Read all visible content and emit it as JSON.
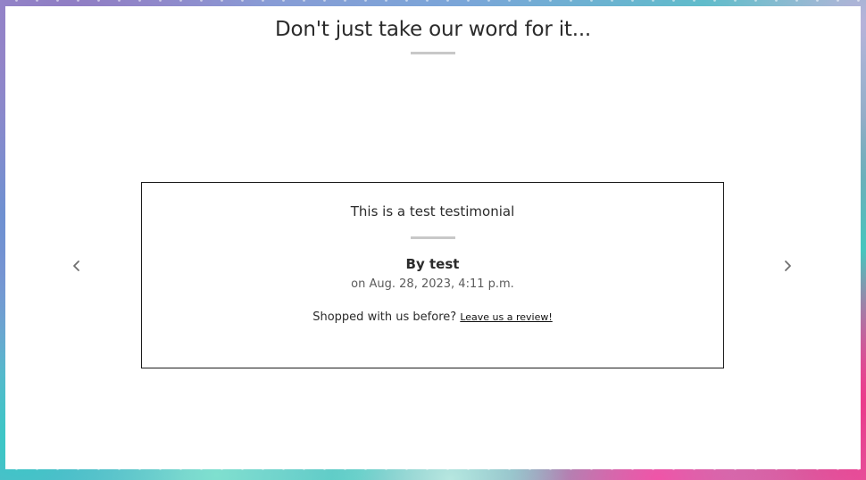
{
  "section": {
    "heading": "Don't just take our word for it..."
  },
  "testimonial": {
    "quote": "This is a test testimonial",
    "author": "By test",
    "date": "on Aug. 28, 2023, 4:11 p.m.",
    "cta_text": "Shopped with us before?",
    "cta_link": "Leave us a review!"
  },
  "carousel": {
    "prev_icon": "chevron-left-icon",
    "next_icon": "chevron-right-icon"
  },
  "colors": {
    "text": "#2b2b2b",
    "muted": "#5b5b5b",
    "rule": "#c8c8c8",
    "card_border": "#1c1c1c"
  }
}
